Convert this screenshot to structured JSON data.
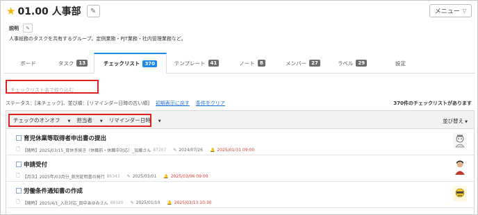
{
  "header": {
    "title": "01.00 人事部",
    "menu_label": "メニュー"
  },
  "description": {
    "label": "説明",
    "text": "人事総務のタスクを共有するグループ。定例業務・PJT業務・社内管理業務など。"
  },
  "tabs": [
    {
      "label": "ボード",
      "badge": ""
    },
    {
      "label": "タスク",
      "badge": "13"
    },
    {
      "label": "チェックリスト",
      "badge": "370"
    },
    {
      "label": "テンプレート",
      "badge": "41"
    },
    {
      "label": "ノート",
      "badge": "8"
    },
    {
      "label": "メンバー",
      "badge": "27"
    },
    {
      "label": "ラベル",
      "badge": "29"
    },
    {
      "label": "設定",
      "badge": ""
    }
  ],
  "filter": {
    "placeholder": "チェックリスト名で絞り込む"
  },
  "status": {
    "text": "ステータス：[未チェック]、並び順：[リマインダー日時の古い順]",
    "reset_link": "初期表示に戻す",
    "clear_link": "条件をクリア",
    "count": "370件のチェックリストがあります"
  },
  "toolbar": {
    "check_toggle": "チェックのオンオフ",
    "assignee": "担当者",
    "reminder": "リマインダー日時",
    "reorder": "並び替え"
  },
  "items": [
    {
      "name": "育児休業等取得者申出書の提出",
      "meta": "【随時】2025/03/15_育休手続き（休職前・休職中対応）_加藤さん",
      "num": "87207",
      "date": "2024/07/26",
      "reminder": "2025/01/31 09:00"
    },
    {
      "name": "申請受付",
      "meta": "【月次】2025年/03月分_就労証明書の発行",
      "num": "86343",
      "date": "2025/03/01",
      "reminder": "2025/03/06 09:00"
    },
    {
      "name": "労働条件通知書の作成",
      "meta": "【随時】2025/4/1_入社対応_田中あゆみさん",
      "num": "88120",
      "date": "2025/01/10",
      "reminder": "2025/03/13 10:30"
    }
  ],
  "colors": {
    "accent": "#1e88e5",
    "highlight_border": "#e02020",
    "reminder_red": "#e53935",
    "star": "#f2b705"
  }
}
